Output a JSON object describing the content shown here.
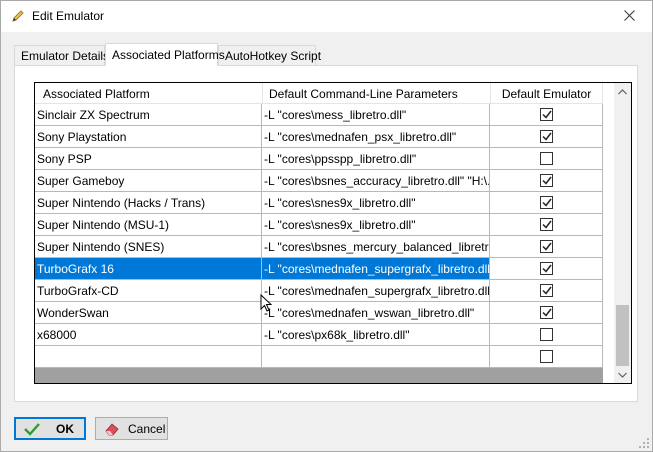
{
  "window": {
    "title": "Edit Emulator",
    "icon": "pencil-icon",
    "close_icon": "close-icon"
  },
  "tabs": [
    {
      "label": "Emulator Details",
      "active": false
    },
    {
      "label": "Associated Platforms",
      "active": true
    },
    {
      "label": "AutoHotkey Script",
      "active": false
    }
  ],
  "grid": {
    "columns": [
      "Associated Platform",
      "Default Command-Line Parameters",
      "Default Emulator"
    ],
    "rows": [
      {
        "platform": "Sinclair ZX Spectrum",
        "params": "-L \"cores\\mess_libretro.dll\"",
        "default": true,
        "selected": false
      },
      {
        "platform": "Sony Playstation",
        "params": "-L \"cores\\mednafen_psx_libretro.dll\"",
        "default": true,
        "selected": false
      },
      {
        "platform": "Sony PSP",
        "params": "-L \"cores\\ppsspp_libretro.dll\"",
        "default": false,
        "selected": false
      },
      {
        "platform": "Super Gameboy",
        "params": "-L \"cores\\bsnes_accuracy_libretro.dll\" \"H:\\...",
        "default": true,
        "selected": false
      },
      {
        "platform": "Super Nintendo (Hacks / Trans)",
        "params": "-L \"cores\\snes9x_libretro.dll\"",
        "default": true,
        "selected": false
      },
      {
        "platform": "Super Nintendo (MSU-1)",
        "params": "-L \"cores\\snes9x_libretro.dll\"",
        "default": true,
        "selected": false
      },
      {
        "platform": "Super Nintendo (SNES)",
        "params": "-L \"cores\\bsnes_mercury_balanced_libretr...",
        "default": true,
        "selected": false
      },
      {
        "platform": "TurboGrafx 16",
        "params": "-L \"cores\\mednafen_supergrafx_libretro.dll\"",
        "default": true,
        "selected": true
      },
      {
        "platform": "TurboGrafx-CD",
        "params": "-L \"cores\\mednafen_supergrafx_libretro.dll\"",
        "default": true,
        "selected": false
      },
      {
        "platform": "WonderSwan",
        "params": "-L \"cores\\mednafen_wswan_libretro.dll\"",
        "default": true,
        "selected": false
      },
      {
        "platform": "x68000",
        "params": "-L \"cores\\px68k_libretro.dll\"",
        "default": false,
        "selected": false
      },
      {
        "platform": "",
        "params": "",
        "default": false,
        "selected": false
      }
    ]
  },
  "buttons": {
    "ok": {
      "label": "OK",
      "icon": "checkmark-icon"
    },
    "cancel": {
      "label": "Cancel",
      "icon": "eraser-icon"
    }
  },
  "colors": {
    "selection": "#0078d7",
    "ok_icon": "#2e9e2e",
    "cancel_icon": "#d8505b"
  }
}
